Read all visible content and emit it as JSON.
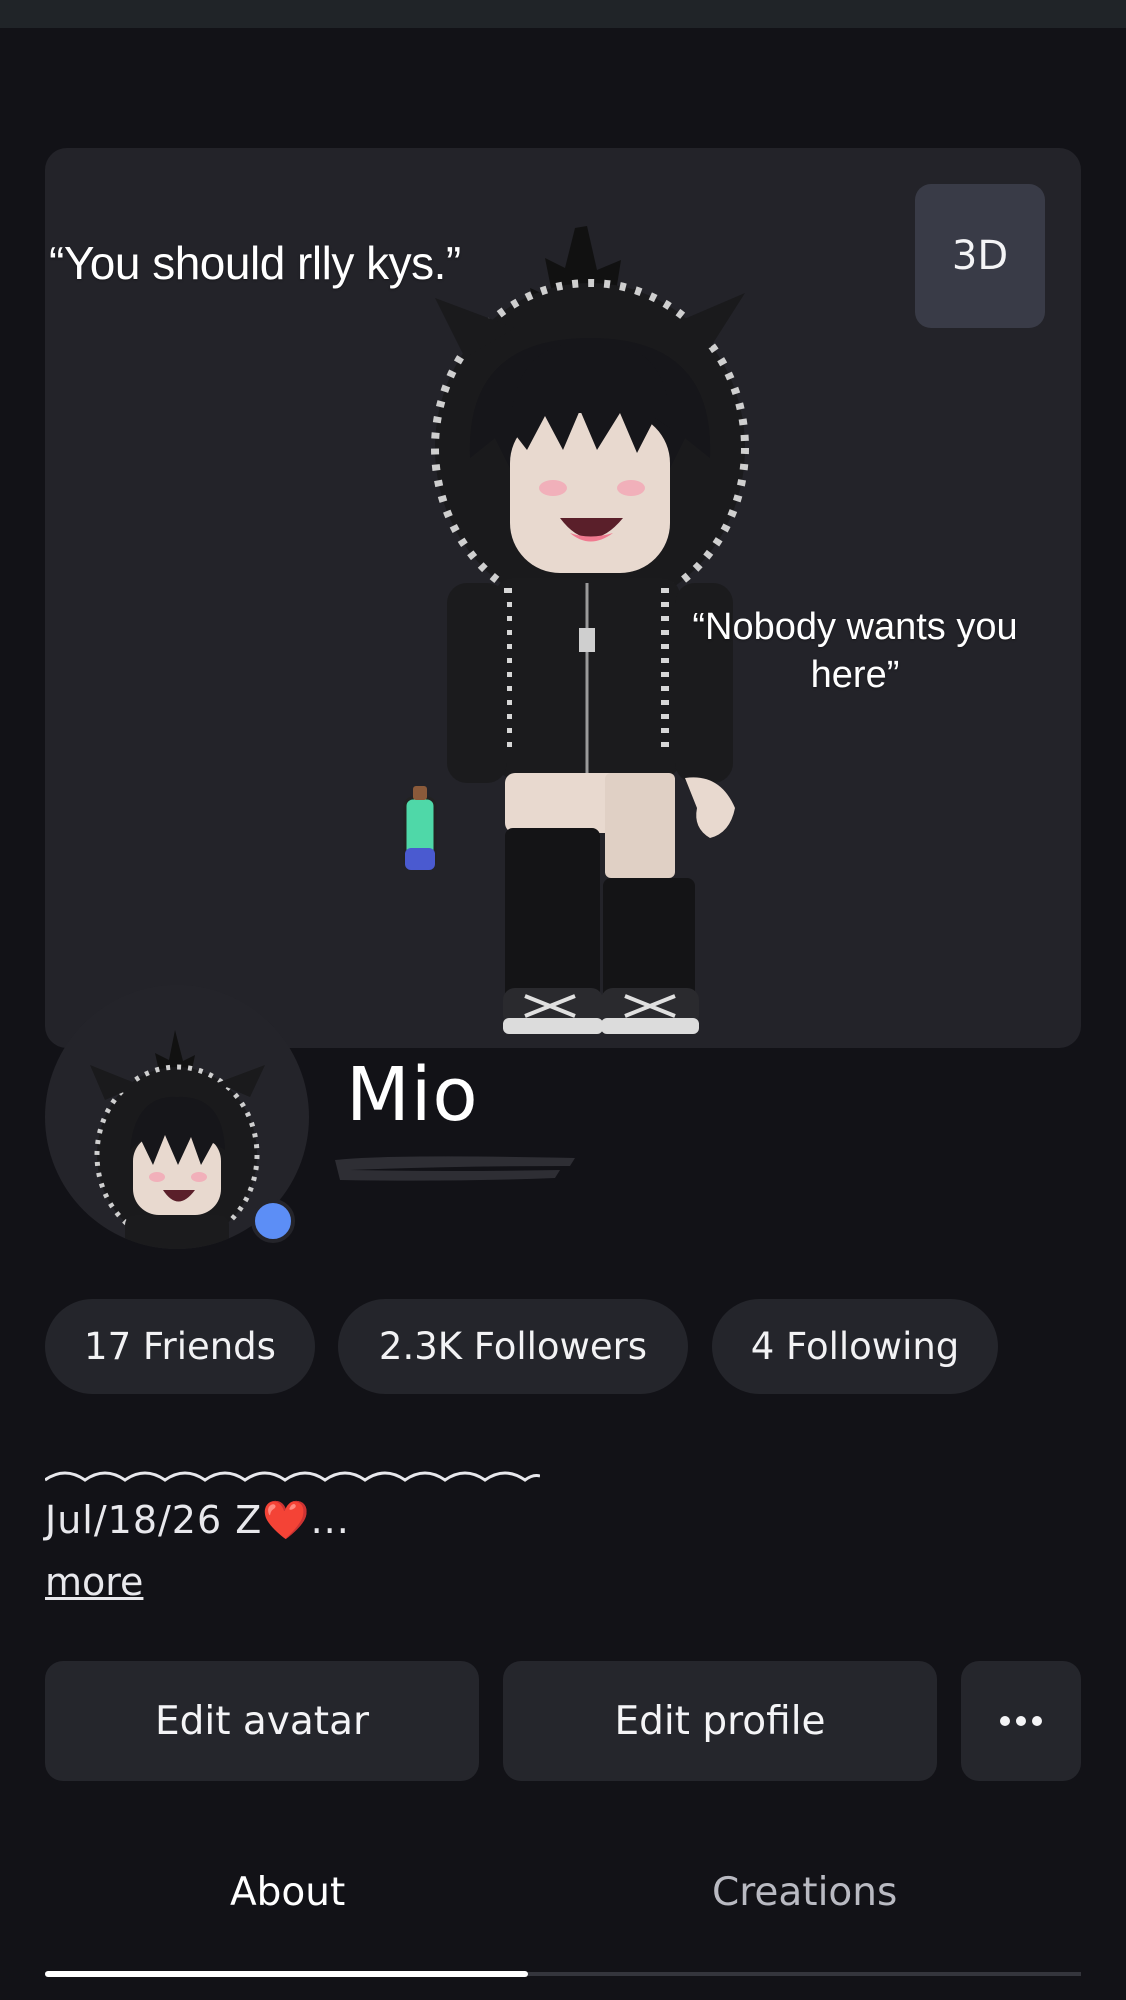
{
  "banner": {
    "view_toggle_label": "3D",
    "captions": [
      "“You should rlly kys.”",
      "“Nobody wants you here”"
    ]
  },
  "profile": {
    "display_name": "Mio",
    "online_status_color": "#5c8ef6"
  },
  "stats": {
    "friends": "17 Friends",
    "followers": "2.3K Followers",
    "following": "4 Following"
  },
  "bio": {
    "text": "Jul/18/26 Z❤️...",
    "more_label": "more"
  },
  "actions": {
    "edit_avatar": "Edit avatar",
    "edit_profile": "Edit profile",
    "more_icon": "more-options-icon"
  },
  "tabs": {
    "items": [
      {
        "label": "About",
        "active": true
      },
      {
        "label": "Creations",
        "active": false
      }
    ]
  }
}
